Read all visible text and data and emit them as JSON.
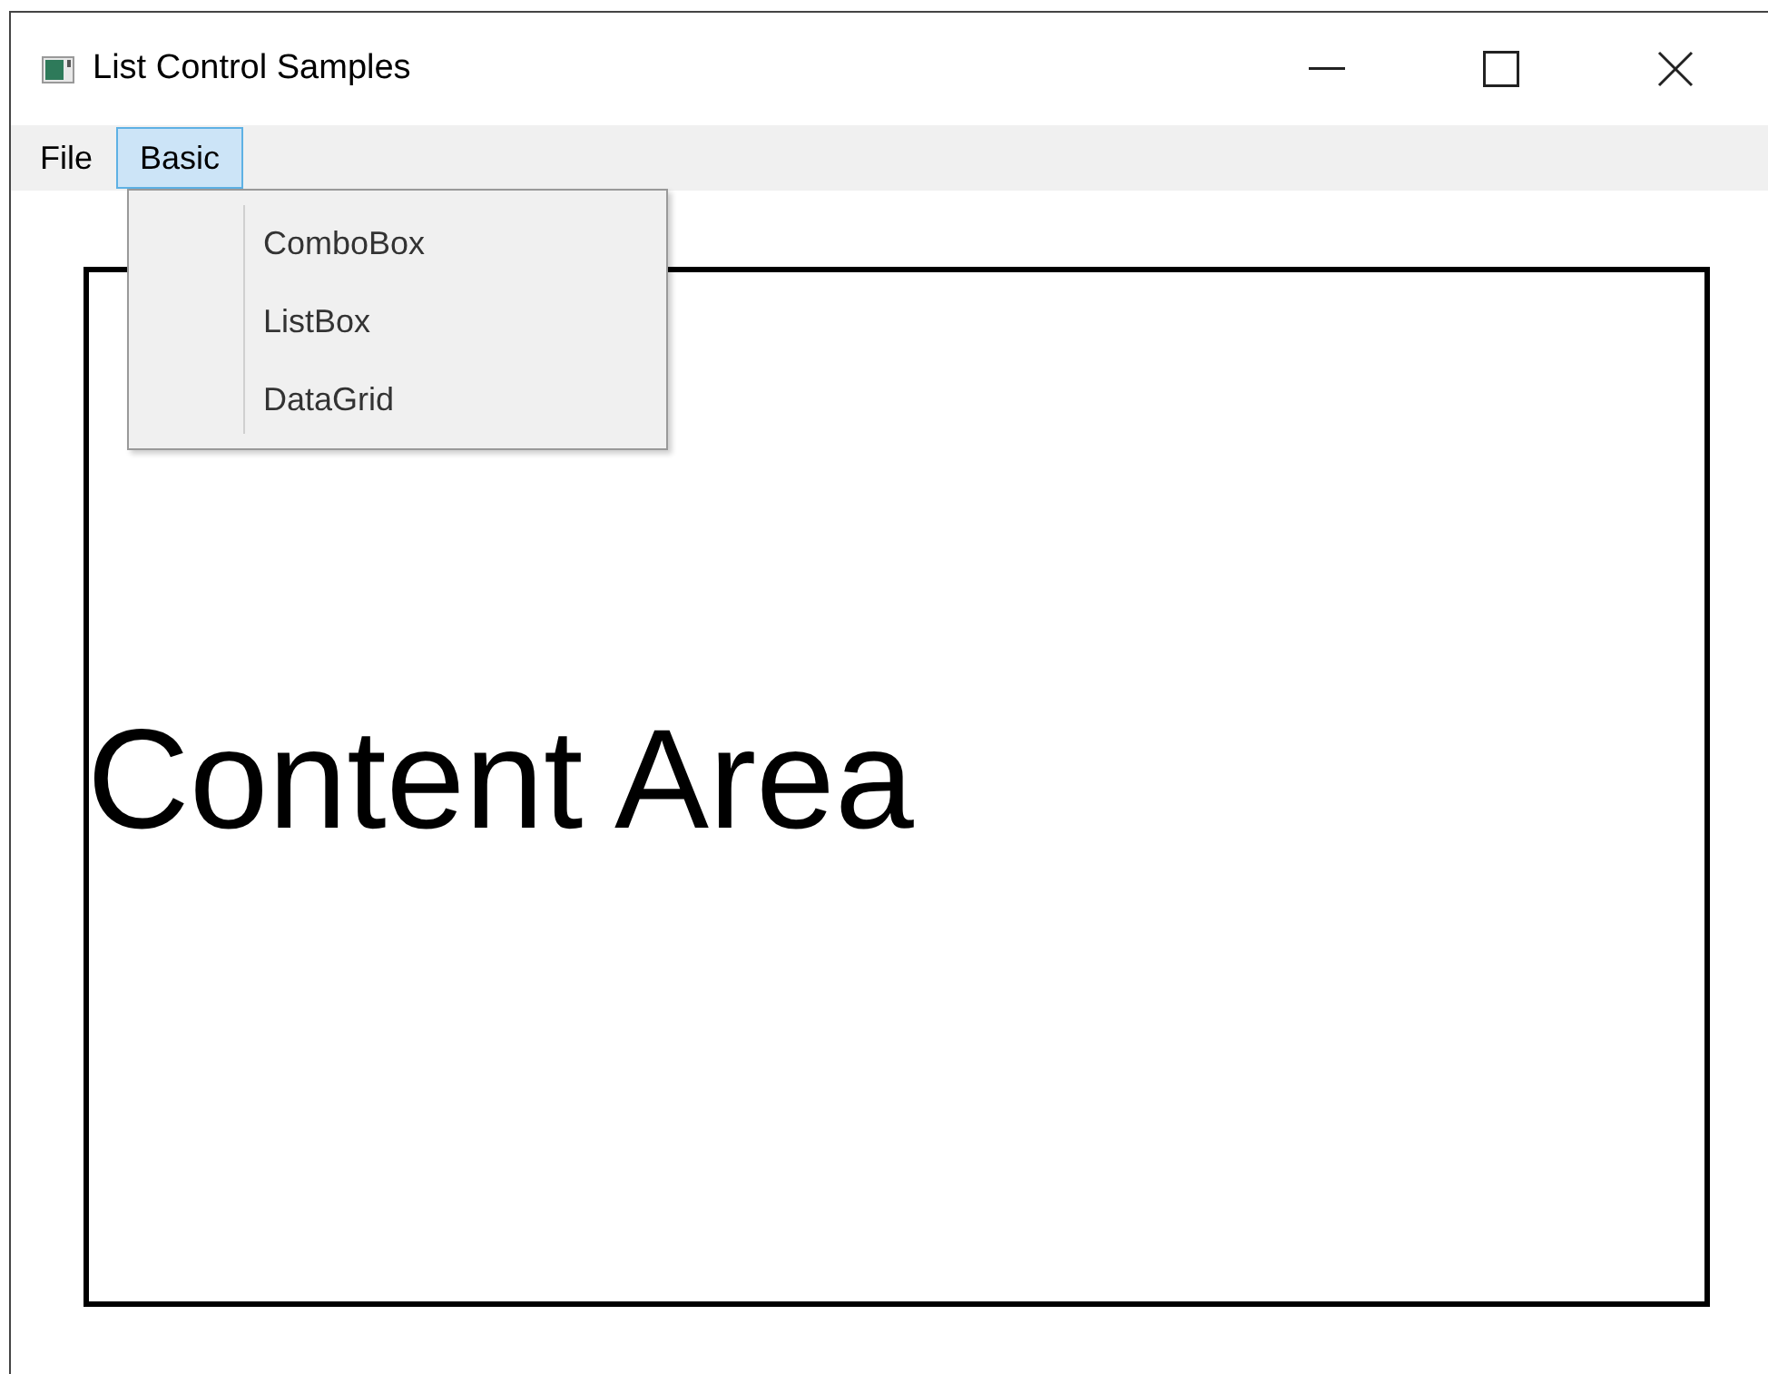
{
  "window": {
    "title": "List Control Samples"
  },
  "menu": [
    {
      "label": "File",
      "selected": false
    },
    {
      "label": "Basic",
      "selected": true
    }
  ],
  "dropdown": {
    "items": [
      {
        "label": "ComboBox"
      },
      {
        "label": "ListBox"
      },
      {
        "label": "DataGrid"
      }
    ]
  },
  "content": {
    "text": "Content Area"
  }
}
